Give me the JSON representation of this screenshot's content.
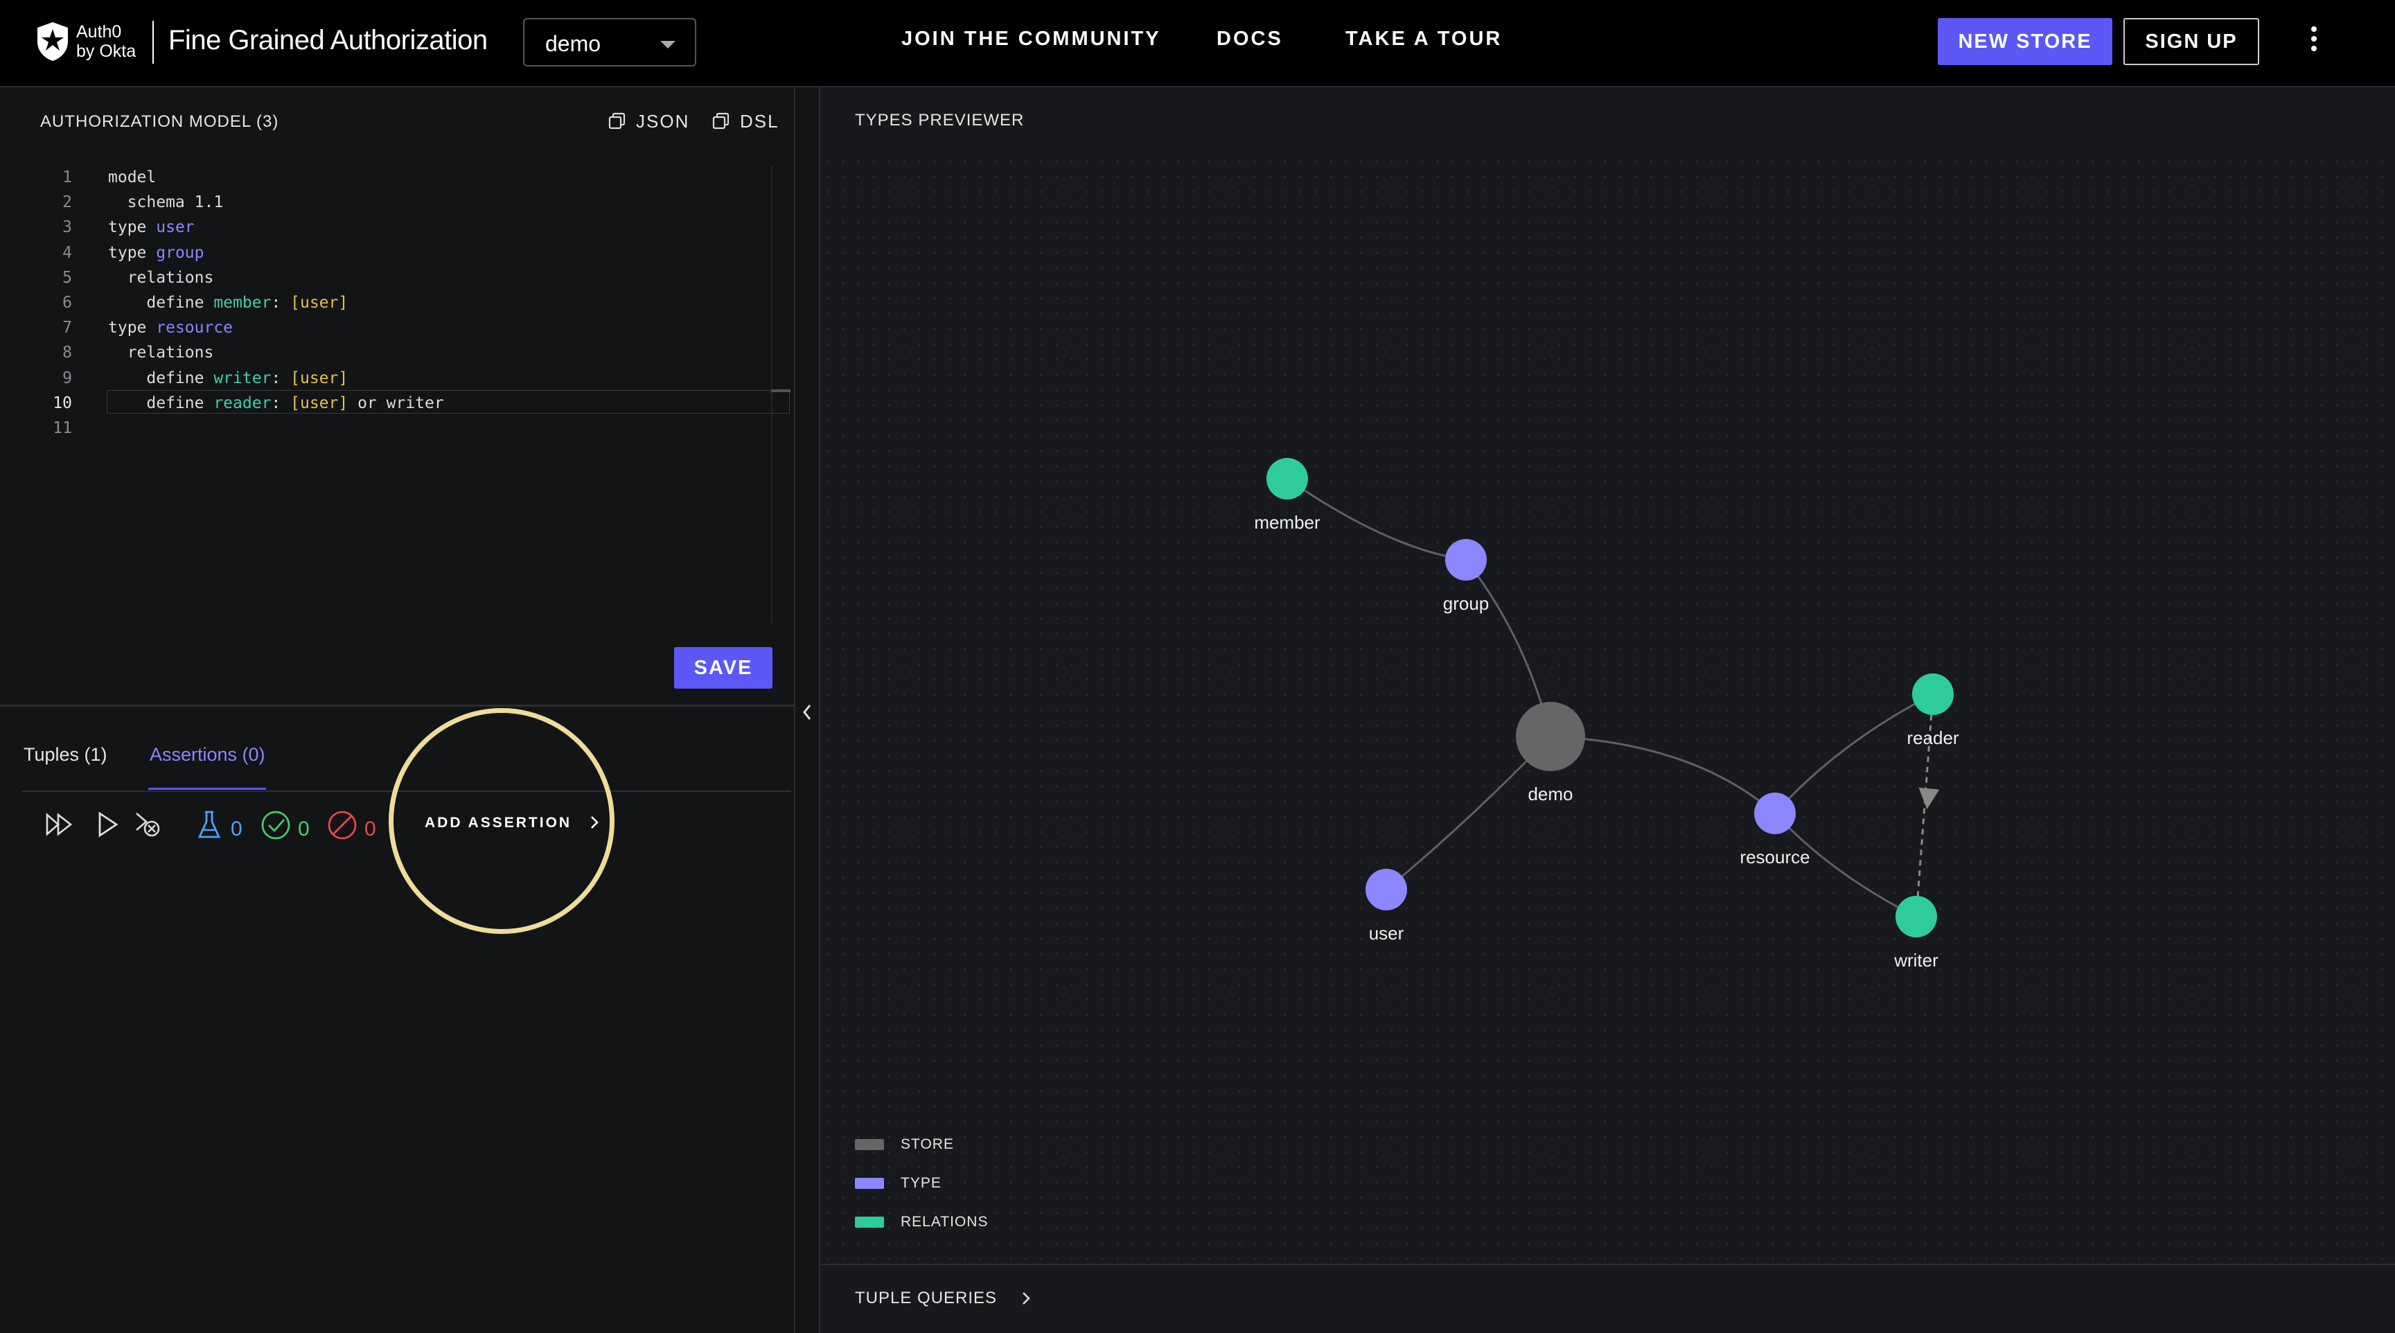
{
  "header": {
    "logo_line1": "Auth0",
    "logo_line2": "by Okta",
    "app_title": "Fine Grained Authorization",
    "store_selected": "demo",
    "nav": [
      "JOIN  THE COMMUNITY",
      "DOCS",
      "TAKE  A  TOUR"
    ],
    "new_store": "NEW STORE",
    "sign_up": "SIGN UP"
  },
  "model": {
    "title": "AUTHORIZATION MODEL (3)",
    "copy_json": "JSON",
    "copy_dsl": "DSL",
    "active_line": 10,
    "lines": [
      {
        "n": "1",
        "code": "model"
      },
      {
        "n": "2",
        "code": "  schema 1.1"
      },
      {
        "n": "3",
        "code": "type user"
      },
      {
        "n": "4",
        "code": "type group"
      },
      {
        "n": "5",
        "code": "  relations"
      },
      {
        "n": "6",
        "code": "    define member: [user]"
      },
      {
        "n": "7",
        "code": "type resource"
      },
      {
        "n": "8",
        "code": "  relations"
      },
      {
        "n": "9",
        "code": "    define writer: [user]"
      },
      {
        "n": "10",
        "code": "    define reader: [user] or writer"
      },
      {
        "n": "11",
        "code": ""
      }
    ],
    "save": "SAVE"
  },
  "bottom_tabs": {
    "tuples": "Tuples (1)",
    "assertions": "Assertions (0)",
    "active": "assertions"
  },
  "assertions_toolbar": {
    "icons": [
      "run-all-icon",
      "run-icon",
      "clear-icon",
      "flask-icon",
      "check-circle-icon",
      "blocked-icon"
    ],
    "total_count": "0",
    "pass_count": "0",
    "fail_count": "0",
    "add_assertion": "ADD ASSERTION",
    "colors": {
      "total": "#4aa3ff",
      "pass": "#3fd06b",
      "fail": "#e5484d"
    }
  },
  "types_previewer": {
    "title": "TYPES PREVIEWER",
    "nodes": [
      {
        "id": "demo",
        "label": "demo",
        "kind": "store"
      },
      {
        "id": "group",
        "label": "group",
        "kind": "type"
      },
      {
        "id": "member",
        "label": "member",
        "kind": "relation"
      },
      {
        "id": "user",
        "label": "user",
        "kind": "type"
      },
      {
        "id": "resource",
        "label": "resource",
        "kind": "type"
      },
      {
        "id": "reader",
        "label": "reader",
        "kind": "relation"
      },
      {
        "id": "writer",
        "label": "writer",
        "kind": "relation"
      }
    ],
    "edges": [
      {
        "from": "group",
        "to": "member"
      },
      {
        "from": "demo",
        "to": "group"
      },
      {
        "from": "demo",
        "to": "user"
      },
      {
        "from": "demo",
        "to": "resource"
      },
      {
        "from": "resource",
        "to": "reader"
      },
      {
        "from": "resource",
        "to": "writer"
      },
      {
        "from": "reader",
        "to": "writer",
        "dashed": true
      }
    ],
    "legend": [
      {
        "label": "STORE",
        "color": "#666666"
      },
      {
        "label": "TYPE",
        "color": "#8b87ff"
      },
      {
        "label": "RELATIONS",
        "color": "#2ecc9a"
      }
    ],
    "colors": {
      "store": "#666666",
      "type": "#8b87ff",
      "relation": "#2ecc9a",
      "edge": "#5f6066"
    }
  },
  "tuple_queries": "TUPLE QUERIES"
}
